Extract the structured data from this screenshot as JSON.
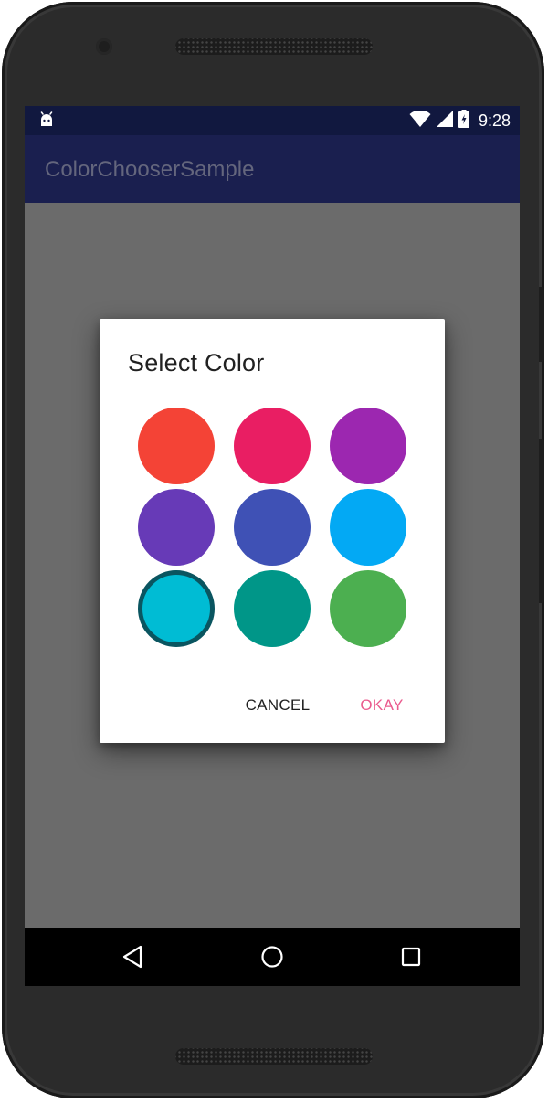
{
  "status_bar": {
    "time": "9:28",
    "icons": [
      "android-icon",
      "wifi-icon",
      "signal-icon",
      "battery-charging-icon"
    ]
  },
  "app_bar": {
    "title": "ColorChooserSample"
  },
  "dialog": {
    "title": "Select Color",
    "swatches": [
      {
        "name": "red",
        "color": "#f44336",
        "selected": false
      },
      {
        "name": "pink",
        "color": "#e91e63",
        "selected": false
      },
      {
        "name": "purple",
        "color": "#9c27b0",
        "selected": false
      },
      {
        "name": "deep-purple",
        "color": "#673ab7",
        "selected": false
      },
      {
        "name": "indigo",
        "color": "#3f51b5",
        "selected": false
      },
      {
        "name": "light-blue",
        "color": "#03a9f4",
        "selected": false
      },
      {
        "name": "cyan",
        "color": "#00bcd4",
        "selected": true
      },
      {
        "name": "teal",
        "color": "#009688",
        "selected": false
      },
      {
        "name": "green",
        "color": "#4caf50",
        "selected": false
      }
    ],
    "cancel_label": "CANCEL",
    "okay_label": "OKAY"
  },
  "nav_bar": {
    "icons": [
      "back-icon",
      "home-icon",
      "recents-icon"
    ]
  },
  "colors": {
    "status_bar": "#11183f",
    "app_bar": "#1a1f4f",
    "scrim": "#6b6b6b",
    "accent": "#ea5a8d",
    "selected_ring": "#0a5560"
  }
}
